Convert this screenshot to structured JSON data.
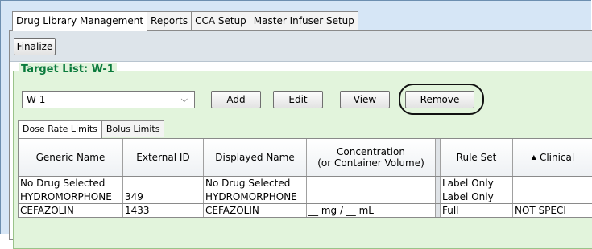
{
  "tabs": [
    "Drug Library Management",
    "Reports",
    "CCA Setup",
    "Master Infuser Setup"
  ],
  "toolbar": {
    "finalize_label_first": "F",
    "finalize_label_rest": "inalize"
  },
  "target_list": {
    "title": "Target List: W-1",
    "selected": "W-1",
    "buttons": {
      "add_first": "A",
      "add_rest": "dd",
      "edit_first": "E",
      "edit_rest": "dit",
      "view_first": "V",
      "view_rest": "iew",
      "remove_first": "R",
      "remove_rest": "emove"
    }
  },
  "inner_tabs": [
    "Dose Rate Limits",
    "Bolus Limits"
  ],
  "table": {
    "headers": {
      "generic_name": "Generic Name",
      "external_id": "External ID",
      "displayed_name": "Displayed Name",
      "concentration_line1": "Concentration",
      "concentration_line2": "(or Container Volume)",
      "rule_set": "Rule Set",
      "clinical": "Clinical"
    },
    "rows": [
      {
        "generic": "No Drug Selected",
        "ext": "",
        "displayed": "No Drug Selected",
        "conc": "",
        "rule": "Label Only",
        "clinical": ""
      },
      {
        "generic": "HYDROMORPHONE",
        "ext": "349",
        "displayed": "HYDROMORPHONE",
        "conc": "",
        "rule": "Label Only",
        "clinical": ""
      },
      {
        "generic": "CEFAZOLIN",
        "ext": "1433",
        "displayed": "CEFAZOLIN",
        "conc": "__ mg / __ mL",
        "rule": "Full",
        "clinical": "NOT SPECI"
      }
    ]
  }
}
